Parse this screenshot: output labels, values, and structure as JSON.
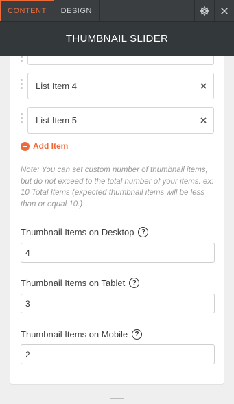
{
  "tabs": [
    {
      "label": "CONTENT",
      "active": true
    },
    {
      "label": "DESIGN",
      "active": false
    }
  ],
  "header": {
    "title": "THUMBNAIL SLIDER"
  },
  "list_items": [
    {
      "label": "List Item 4"
    },
    {
      "label": "List Item 5"
    }
  ],
  "add_item_label": "Add Item",
  "note": "Note: You can set custom number of thumbnail items, but do not exceed to the total number of your items. ex: 10 Total Items (expected thumbnail items will be less than or equal 10.)",
  "fields": {
    "desktop": {
      "label": "Thumbnail Items on Desktop",
      "value": "4"
    },
    "tablet": {
      "label": "Thumbnail Items on Tablet",
      "value": "3"
    },
    "mobile": {
      "label": "Thumbnail Items on Mobile",
      "value": "2"
    }
  },
  "help_glyph": "?",
  "colors": {
    "accent": "#ef6a3b",
    "header_bg": "#33383a",
    "tabbar_bg": "#3a3e40"
  },
  "icons": [
    "gear-icon",
    "close-icon",
    "remove-icon",
    "add-icon",
    "help-icon",
    "drag-handle-icon",
    "resize-handle-icon"
  ]
}
